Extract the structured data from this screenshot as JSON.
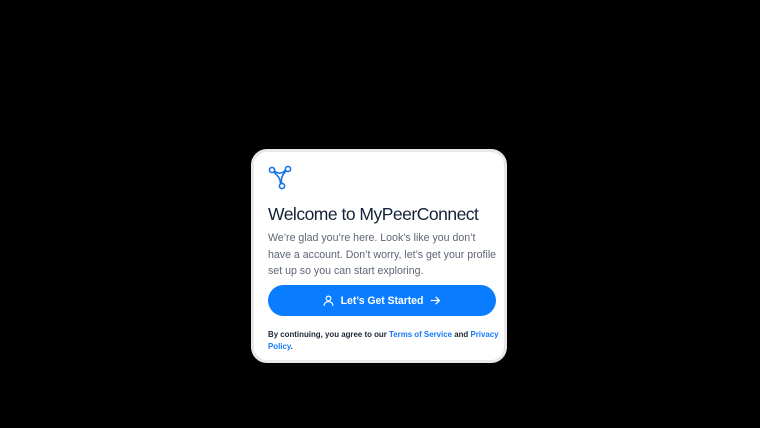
{
  "app": {
    "name": "MyPeerConnect"
  },
  "colors": {
    "background": "#000000",
    "card": "#ffffff",
    "accent": "#0a7cff",
    "title": "#152238",
    "body_text": "#5d6675",
    "link": "#1677ff"
  },
  "icons": {
    "logo": "tri-node-logo-icon",
    "cta_leading": "user-icon",
    "cta_trailing": "arrow-right-icon"
  },
  "welcome": {
    "title": "Welcome to MyPeerConnect",
    "description": "We’re glad you’re here. Look’s like you don’t have a account. Don’t worry, let’s get your profile set up so you can start exploring.",
    "cta_label": "Let’s Get Started"
  },
  "legal": {
    "prefix": "By continuing, you agree to our ",
    "terms_link": "Terms of Service",
    "conjunction": " and ",
    "privacy_link": "Privacy Policy",
    "suffix": "."
  }
}
